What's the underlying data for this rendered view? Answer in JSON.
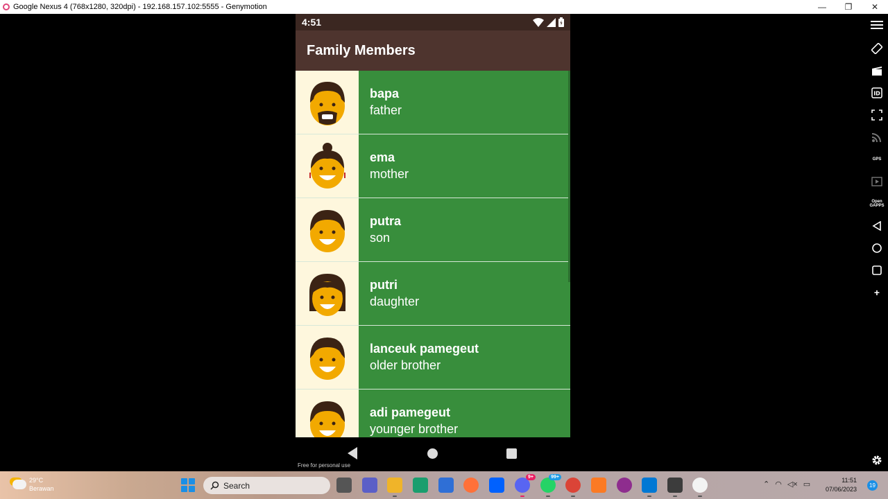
{
  "window": {
    "title": "Google Nexus 4 (768x1280, 320dpi) - 192.168.157.102:5555 - Genymotion",
    "minimize": "—",
    "maximize": "❐",
    "close": "✕"
  },
  "toolbar": {
    "icons": [
      "menu-icon",
      "rotate-icon",
      "camera-icon",
      "id-icon",
      "fullscreen-icon",
      "cast-icon",
      "gps-icon",
      "media-icon",
      "open-gapps-icon",
      "back-icon",
      "home-icon",
      "recents-icon",
      "add-icon",
      "settings-icon"
    ],
    "gps_label": "GPS",
    "gapps_label": "Open GAPPS",
    "id_label": "ID",
    "add_label": "+"
  },
  "device": {
    "status_time": "4:51",
    "app_title": "Family Members",
    "members": [
      {
        "name": "bapa",
        "role": "father"
      },
      {
        "name": "ema",
        "role": "mother"
      },
      {
        "name": "putra",
        "role": "son"
      },
      {
        "name": "putri",
        "role": "daughter"
      },
      {
        "name": "lanceuk pamegeut",
        "role": "older brother"
      },
      {
        "name": "adi pamegeut",
        "role": "younger brother"
      }
    ],
    "watermark": "Free for personal use"
  },
  "taskbar": {
    "weather_temp": "29°C",
    "weather_desc": "Berawan",
    "search_placeholder": "Search",
    "discord_badge": "9+",
    "whatsapp_badge": "99+",
    "time": "11:51",
    "date": "07/06/2023",
    "notifications": "19"
  },
  "colors": {
    "status_bar": "#3b2721",
    "app_bar": "#4e342e",
    "list_text_bg": "#388e3c",
    "avatar_bg": "#fef7dd"
  }
}
